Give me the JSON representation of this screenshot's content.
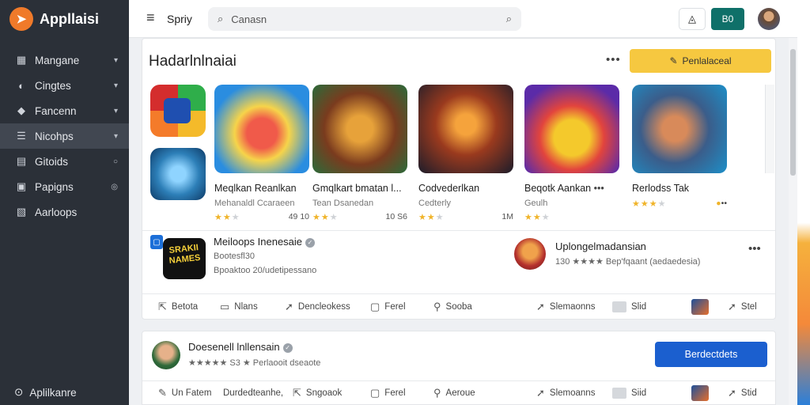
{
  "app": {
    "name": "Appllaisi"
  },
  "sidebar": {
    "items": [
      {
        "label": "Mangane",
        "icon": "grid-icon",
        "trail": "▾"
      },
      {
        "label": "Cingtes",
        "icon": "palette-icon",
        "trail": "▾"
      },
      {
        "label": "Fancenn",
        "icon": "tag-icon",
        "trail": "▾"
      },
      {
        "label": "Nicohps",
        "icon": "list-icon",
        "trail": "▾"
      },
      {
        "label": "Gitoids",
        "icon": "document-icon",
        "trail": "○"
      },
      {
        "label": "Papigns",
        "icon": "ticket-icon",
        "trail": "◎"
      },
      {
        "label": "Aarloops",
        "icon": "image-icon",
        "trail": ""
      }
    ],
    "footer_label": "Aplilkanre"
  },
  "topbar": {
    "title": "Spriy",
    "search_value": "Canasn",
    "button_label": "B0"
  },
  "section": {
    "title": "Hadarlnlnaiai",
    "more": "•••",
    "cta_label": "Penlalaceal"
  },
  "cards": [
    {
      "title": "Meqlkan Reanlkan",
      "subtitle": "Mehanaldl Ccaraeen",
      "stars": 2,
      "value": "49 10"
    },
    {
      "title": "Gmqlkart bmatan l...",
      "subtitle": "Tean Dsanedan",
      "stars": 2,
      "value": "10 S6"
    },
    {
      "title": "Codvederlkan",
      "subtitle": "Cedterly",
      "stars": 2,
      "value": "1M"
    },
    {
      "title": "Beqotk Aankan",
      "subtitle": "Geulh",
      "stars": 2,
      "value": ""
    },
    {
      "title": "Rerlodss Tak",
      "subtitle": "",
      "stars": 3,
      "value": ""
    }
  ],
  "row1": {
    "title": "Meiloops Inenesaie",
    "sub1": "Bootesfl30",
    "sub2": "Bpoaktoo 20/udetipessano",
    "app_text": "SRAKII NAMES",
    "right_title": "Uplongelmadansian",
    "right_sub": "130 ★★★★  Bep'fqaant  (aedaedesia)"
  },
  "actions_row1": [
    "Betota",
    "Nlans",
    "Dencleokess",
    "Ferel",
    "Sooba",
    "Slemaonns",
    "Slid",
    "Stel"
  ],
  "panel2": {
    "title": "Doesenell lnllensain",
    "sub": "★★★★★  S3 ★  Perlaooit dseaote",
    "button": "Berdectdets"
  },
  "actions_row2": [
    "Un Fatem",
    "Durdedteanhe,",
    "Sngoaok",
    "Ferel",
    "Aeroue",
    "Slemoanns",
    "Siid",
    "Stid"
  ],
  "colors": {
    "sidebar": "#2b3038",
    "accent_yellow": "#f6c840",
    "accent_blue": "#1b5fcf",
    "accent_teal": "#0f7069",
    "brand": "#f07a2a"
  }
}
